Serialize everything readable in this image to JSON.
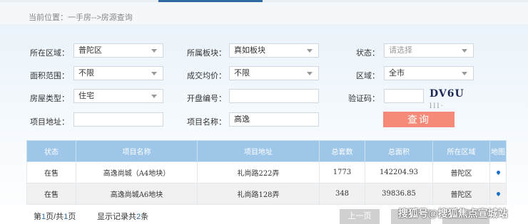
{
  "breadcrumb": "当前位置：一手房-->房源查询",
  "form": {
    "region_label": "所在区域：",
    "region_value": "普陀区",
    "block_label": "所属板块：",
    "block_value": "真如板块",
    "status_label": "状态：",
    "status_placeholder": "请选择",
    "area_label": "面积范围：",
    "area_value": "不限",
    "price_label": "成交均价：",
    "price_value": "不限",
    "district_label": "区域：",
    "district_value": "全市",
    "type_label": "房屋类型：",
    "type_value": "住宅",
    "opening_label": "开盘编号：",
    "opening_value": "",
    "captcha_label": "验证码：",
    "captcha_input": "",
    "captcha_text": "DV6U",
    "captcha_noise": "lll·",
    "address_label": "项目地址：",
    "address_value": "",
    "name_label": "项目名称：",
    "name_value": "高逸",
    "query_button": "查询"
  },
  "table": {
    "headers": [
      "状态",
      "项目名称",
      "项目地址",
      "总套数",
      "总面积",
      "所在区域",
      "地图"
    ],
    "rows": [
      {
        "status": "在售",
        "name": "高逸尚城（A4地块）",
        "address": "礼尚路222弄",
        "units": "1773",
        "area": "142204.93",
        "region": "普陀区",
        "map": "map-pin-icon"
      },
      {
        "status": "在售",
        "name": "高逸尚城A6地块",
        "address": "礼尚路128弄",
        "units": "348",
        "area": "39836.85",
        "region": "普陀区",
        "map": "map-pin-icon"
      }
    ]
  },
  "pager": {
    "page_prefix": "第",
    "page_current": "1",
    "page_mid": "页/共",
    "page_total": "1",
    "page_suffix": "页",
    "records_prefix": "显示记录共",
    "records_count": "2",
    "records_suffix": "条",
    "prev_label": "上一页"
  },
  "watermark": "搜狐号@搜狐焦点宣城站",
  "colors": {
    "query_button": "#f58a78",
    "table_header": "#9ec6e8",
    "onsale": "#3a9a3a",
    "accent": "#2f6aa3"
  }
}
